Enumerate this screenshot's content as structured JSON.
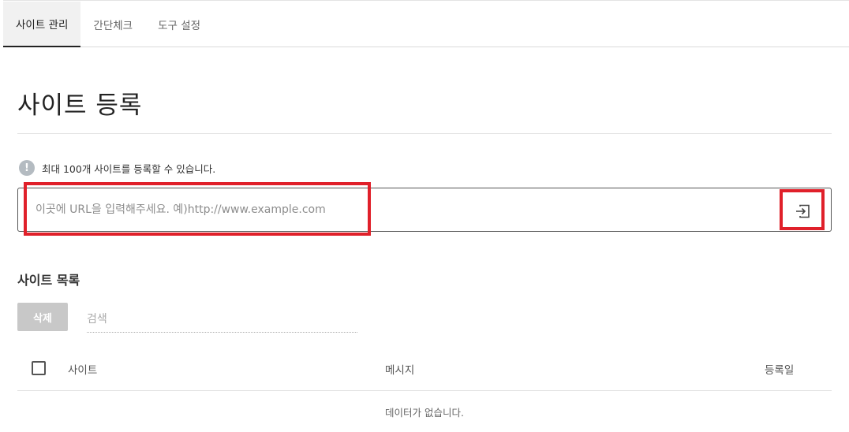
{
  "tabs": [
    {
      "label": "사이트 관리",
      "active": true
    },
    {
      "label": "간단체크",
      "active": false
    },
    {
      "label": "도구 설정",
      "active": false
    }
  ],
  "page": {
    "title": "사이트 등록",
    "notice": {
      "icon": "exclamation-icon",
      "text": "최대 100개 사이트를 등록할 수 있습니다."
    },
    "url_input": {
      "value": "",
      "placeholder": "이곳에 URL을 입력해주세요. 예)http://www.example.com"
    },
    "submit_icon": "enter-arrow-icon"
  },
  "site_list": {
    "title": "사이트 목록",
    "delete_label": "삭제",
    "search_placeholder": "검색",
    "columns": [
      "사이트",
      "메시지",
      "등록일"
    ],
    "empty_text": "데이터가 없습니다."
  },
  "colors": {
    "highlight": "#e0202a",
    "delete_button": "#c8c8c8",
    "notice_icon": "#b4bbc1"
  }
}
